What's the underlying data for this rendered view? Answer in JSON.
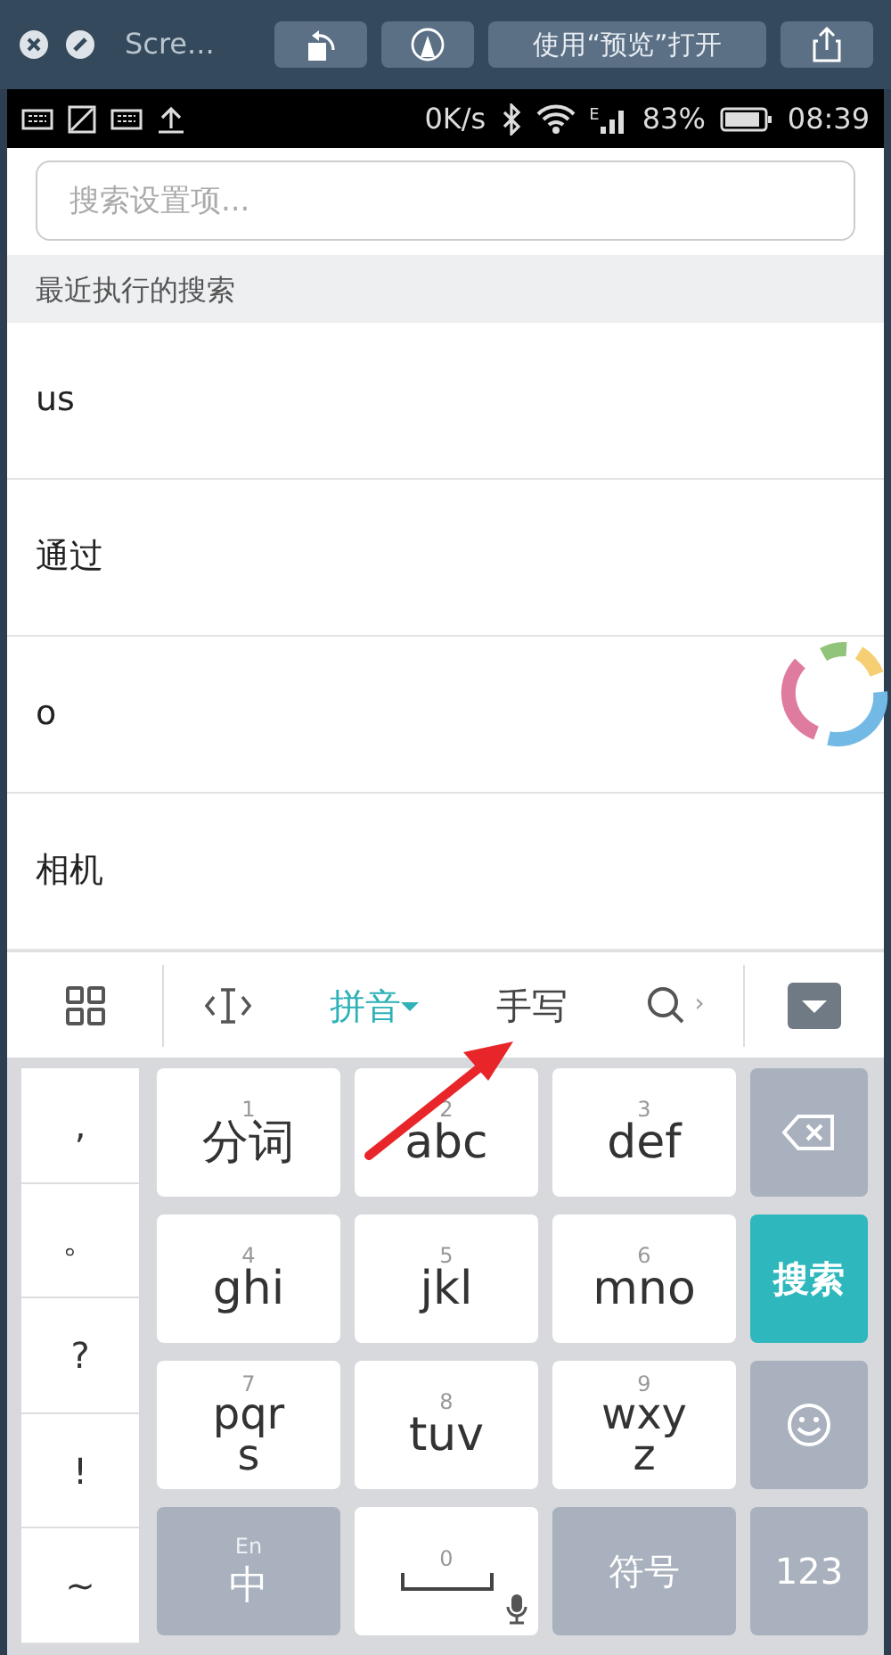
{
  "window": {
    "title": "Scre...",
    "buttons": [
      {
        "kind": "rotate"
      },
      {
        "kind": "markup"
      },
      {
        "kind": "text",
        "label": "使用“预览”打开"
      },
      {
        "kind": "share"
      }
    ]
  },
  "status_bar": {
    "speed": "0K/s",
    "network": "E",
    "battery": "83%",
    "time": "08:39"
  },
  "search": {
    "placeholder": "搜索设置项..."
  },
  "recent": {
    "title": "最近执行的搜索",
    "items": [
      "us",
      "通过",
      "o",
      "相机"
    ]
  },
  "keyboard_toolbar": {
    "tabs": [
      {
        "label": "拼音",
        "selected": true
      },
      {
        "label": "手写",
        "selected": false
      }
    ],
    "more": "›"
  },
  "symbols": [
    ",",
    "。",
    "?",
    "!",
    "~"
  ],
  "keys": [
    {
      "kind": "letter",
      "number": "1",
      "label": "分词"
    },
    {
      "kind": "letter",
      "number": "2",
      "label": "abc"
    },
    {
      "kind": "letter",
      "number": "3",
      "label": "def"
    },
    {
      "kind": "delete"
    },
    {
      "kind": "letter",
      "number": "4",
      "label": "ghi"
    },
    {
      "kind": "letter",
      "number": "5",
      "label": "jkl"
    },
    {
      "kind": "letter",
      "number": "6",
      "label": "mno"
    },
    {
      "kind": "enter",
      "label": "搜索"
    },
    {
      "kind": "letter",
      "number": "7",
      "label": "pqr s"
    },
    {
      "kind": "letter",
      "number": "8",
      "label": "tuv"
    },
    {
      "kind": "letter",
      "number": "9",
      "label": "wxy z"
    },
    {
      "kind": "emoji"
    },
    {
      "kind": "mode",
      "number": "En",
      "label": "中"
    },
    {
      "kind": "space",
      "number": "0"
    },
    {
      "kind": "function",
      "label": "符号"
    },
    {
      "kind": "function",
      "label": "123"
    }
  ]
}
